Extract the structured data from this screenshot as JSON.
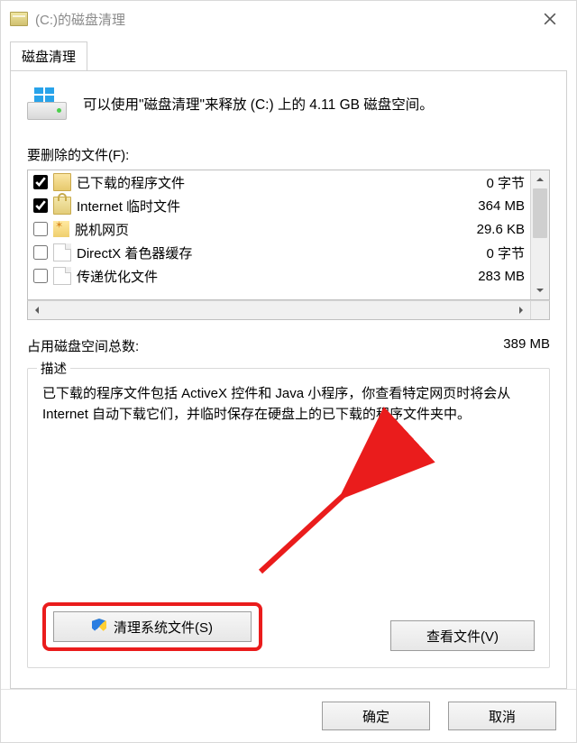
{
  "title": "(C:)的磁盘清理",
  "tab_label": "磁盘清理",
  "intro": "可以使用\"磁盘清理\"来释放  (C:) 上的 4.11 GB 磁盘空间。",
  "files_label": "要删除的文件(F):",
  "rows": [
    {
      "checked": true,
      "icon": "folder",
      "name": "已下载的程序文件",
      "size": "0 字节"
    },
    {
      "checked": true,
      "icon": "lock",
      "name": "Internet 临时文件",
      "size": "364 MB"
    },
    {
      "checked": false,
      "icon": "web",
      "name": "脱机网页",
      "size": "29.6 KB"
    },
    {
      "checked": false,
      "icon": "file",
      "name": "DirectX 着色器缓存",
      "size": "0 字节"
    },
    {
      "checked": false,
      "icon": "file",
      "name": "传递优化文件",
      "size": "283 MB"
    }
  ],
  "total_label": "占用磁盘空间总数:",
  "total_value": "389 MB",
  "desc_legend": "描述",
  "desc_text": "已下载的程序文件包括 ActiveX 控件和 Java 小程序，你查看特定网页时将会从 Internet 自动下载它们，并临时保存在硬盘上的已下载的程序文件夹中。",
  "btn_clean_system": "清理系统文件(S)",
  "btn_view_files": "查看文件(V)",
  "btn_ok": "确定",
  "btn_cancel": "取消"
}
